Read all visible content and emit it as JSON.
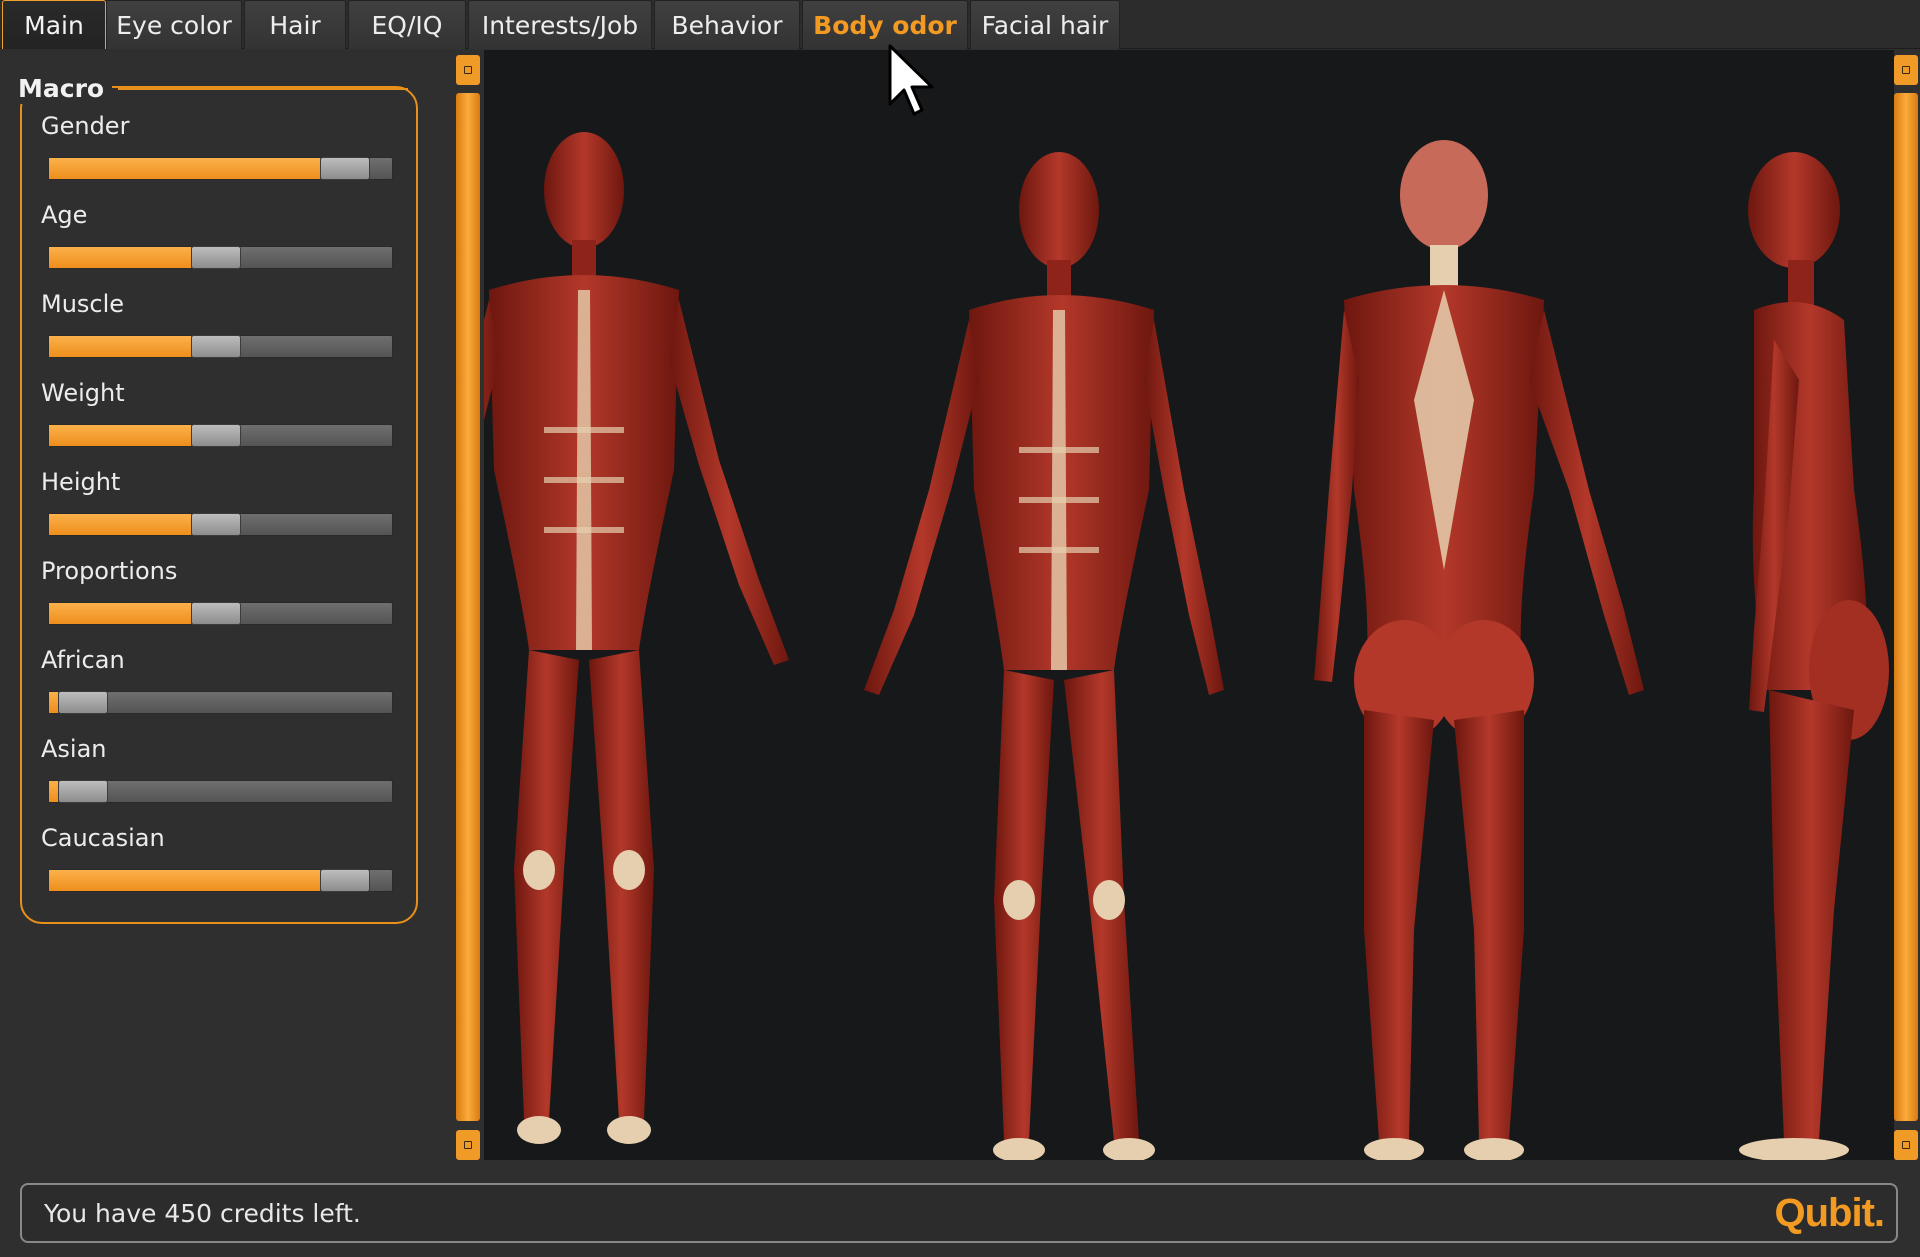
{
  "tabs": [
    {
      "label": "Main",
      "state": "active"
    },
    {
      "label": "Eye color",
      "state": "normal"
    },
    {
      "label": "Hair",
      "state": "normal"
    },
    {
      "label": "EQ/IQ",
      "state": "normal"
    },
    {
      "label": "Interests/Job",
      "state": "normal"
    },
    {
      "label": "Behavior",
      "state": "normal"
    },
    {
      "label": "Body odor",
      "state": "hover"
    },
    {
      "label": "Facial hair",
      "state": "normal"
    }
  ],
  "macro": {
    "title": "Macro",
    "sliders": [
      {
        "label": "Gender",
        "value": 0.92
      },
      {
        "label": "Age",
        "value": 0.48
      },
      {
        "label": "Muscle",
        "value": 0.48
      },
      {
        "label": "Weight",
        "value": 0.48
      },
      {
        "label": "Height",
        "value": 0.48
      },
      {
        "label": "Proportions",
        "value": 0.48
      },
      {
        "label": "African",
        "value": 0.03
      },
      {
        "label": "Asian",
        "value": 0.03
      },
      {
        "label": "Caucasian",
        "value": 0.92
      }
    ]
  },
  "status": {
    "message": "You have 450 credits left.",
    "logo": "Qubit."
  },
  "colors": {
    "accent": "#f29a22",
    "background": "#2f2f2f",
    "viewport": "#17181a",
    "muscle": "#9c2a1e",
    "tendon": "#e6cfae"
  }
}
